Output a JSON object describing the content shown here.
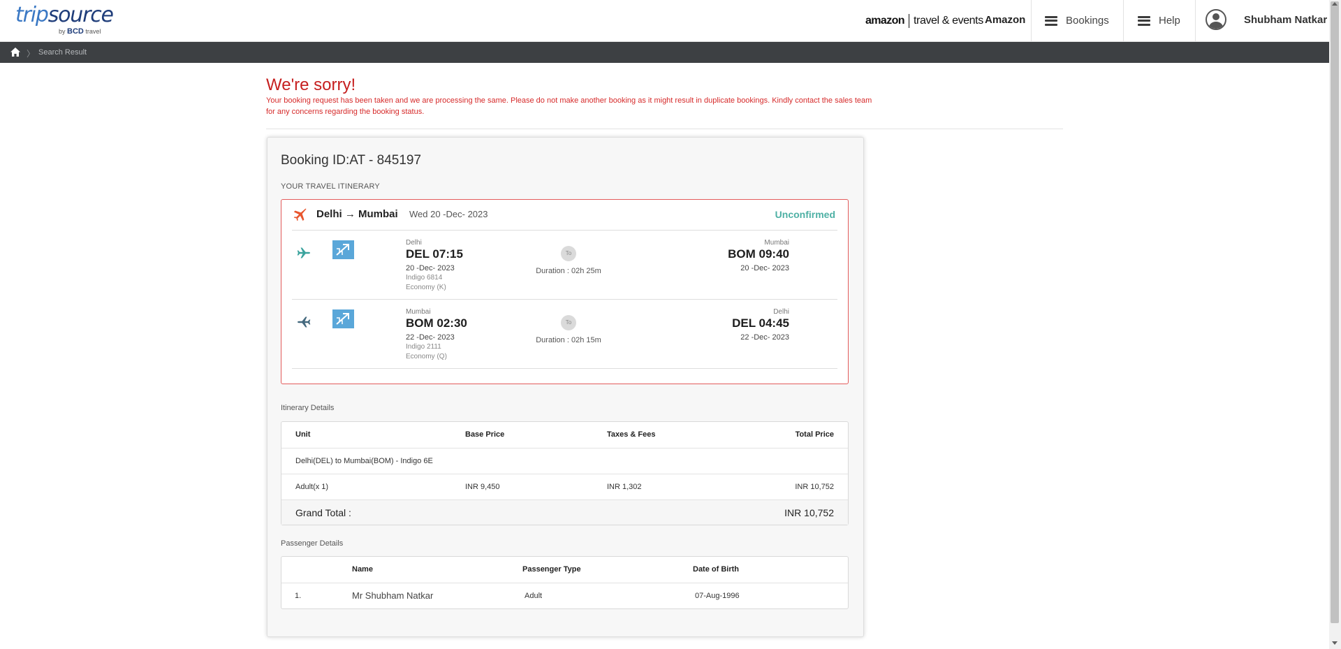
{
  "header": {
    "logo_trip": "trip",
    "logo_source": "source",
    "logo_by": "by",
    "logo_bcd": "BCD",
    "logo_travel": "travel",
    "partner_brand": "amazon",
    "partner_program": "travel & events",
    "company": "Amazon",
    "nav": [
      {
        "label": "Bookings",
        "icon": "hamburger-icon"
      },
      {
        "label": "Help",
        "icon": "hamburger-icon"
      }
    ],
    "user_name": "Shubham Natkar"
  },
  "breadcrumb": {
    "home_icon": "home-icon",
    "current": "Search Result"
  },
  "message": {
    "title": "We're sorry!",
    "text": "Your booking request has been taken and we are processing the same. Please do not make another booking as it might result in duplicate bookings. Kindly contact the sales team for any concerns regarding the booking status."
  },
  "booking": {
    "id": "Booking ID:AT - 845197",
    "itinerary_label": "YOUR TRAVEL ITINERARY",
    "route": "Delhi → Mumbai",
    "route_date": "Wed 20 -Dec- 2023",
    "status": "Unconfirmed",
    "status_color": "#4db0a4",
    "accent_color": "#e35b5b",
    "segments": [
      {
        "from_city": "Delhi",
        "from_time": "DEL 07:15",
        "from_date": "20 -Dec- 2023",
        "flight_no": "Indigo 6814",
        "cabin": "Economy (K)",
        "to_label": "To",
        "duration": "Duration : 02h 25m",
        "to_city": "Mumbai",
        "to_time": "BOM 09:40",
        "to_date": "20 -Dec- 2023",
        "icon_color": "#3aa39d"
      },
      {
        "from_city": "Mumbai",
        "from_time": "BOM 02:30",
        "from_date": "22 -Dec- 2023",
        "flight_no": "Indigo 2111",
        "cabin": "Economy (Q)",
        "to_label": "To",
        "duration": "Duration : 02h 15m",
        "to_city": "Delhi",
        "to_time": "DEL 04:45",
        "to_date": "22 -Dec- 2023",
        "icon_color": "#44697e"
      }
    ]
  },
  "itinerary_details": {
    "label": "Itinerary Details",
    "headers": [
      "Unit",
      "Base Price",
      "Taxes & Fees",
      "Total Price"
    ],
    "route_row": "Delhi(DEL) to Mumbai(BOM) - Indigo 6E",
    "fare_row": [
      "Adult(x 1)",
      "INR 9,450",
      "INR 1,302",
      "INR 10,752"
    ],
    "grand_total_label": "Grand Total :",
    "grand_total_value": "INR 10,752"
  },
  "passenger_details": {
    "label": "Passenger Details",
    "headers": [
      "Name",
      "Passenger Type",
      "Date of Birth"
    ],
    "rows": [
      {
        "index": "1.",
        "name": "Mr Shubham Natkar",
        "type": "Adult",
        "dob": "07-Aug-1996"
      }
    ]
  }
}
